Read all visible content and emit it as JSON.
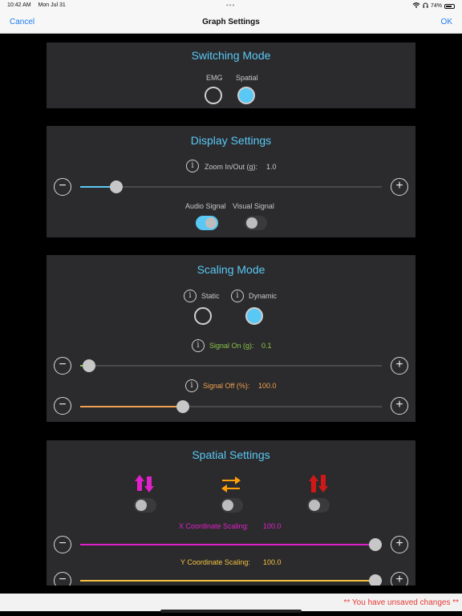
{
  "status": {
    "time": "10:42 AM",
    "date": "Mon Jul 31",
    "battery": "74%"
  },
  "nav": {
    "cancel": "Cancel",
    "title": "Graph Settings",
    "ok": "OK"
  },
  "switching": {
    "title": "Switching Mode",
    "emg_label": "EMG",
    "spatial_label": "Spatial",
    "selected": "Spatial"
  },
  "display": {
    "title": "Display Settings",
    "zoom_label": "Zoom In/Out (g):",
    "zoom_value": "1.0",
    "zoom_level": 0.12,
    "audio_label": "Audio Signal",
    "visual_label": "Visual Signal",
    "audio_on": true,
    "visual_on": false
  },
  "scaling": {
    "title": "Scaling Mode",
    "static_label": "Static",
    "dynamic_label": "Dynamic",
    "selected": "Dynamic",
    "signal_on_label": "Signal On (g):",
    "signal_on_value": "0.1",
    "signal_on_level": 0.03,
    "signal_off_label": "Signal Off (%):",
    "signal_off_value": "100.0",
    "signal_off_level": 0.34
  },
  "spatial": {
    "title": "Spatial Settings",
    "x_label": "X Coordinate Scaling:",
    "x_value": "100.0",
    "x_level": 1.0,
    "y_label": "Y Coordinate Scaling:",
    "y_value": "100.0",
    "y_level": 1.0,
    "toggles": [
      false,
      false,
      false
    ]
  },
  "colors": {
    "accent": "#5ac8f5",
    "green": "#8bc34a",
    "orange": "#f0a050",
    "magenta": "#e020c8",
    "gold": "#f5c242",
    "red": "#d01818",
    "arrow_orange": "#ff9f0a"
  },
  "unsaved_msg": "** You have unsaved changes **"
}
